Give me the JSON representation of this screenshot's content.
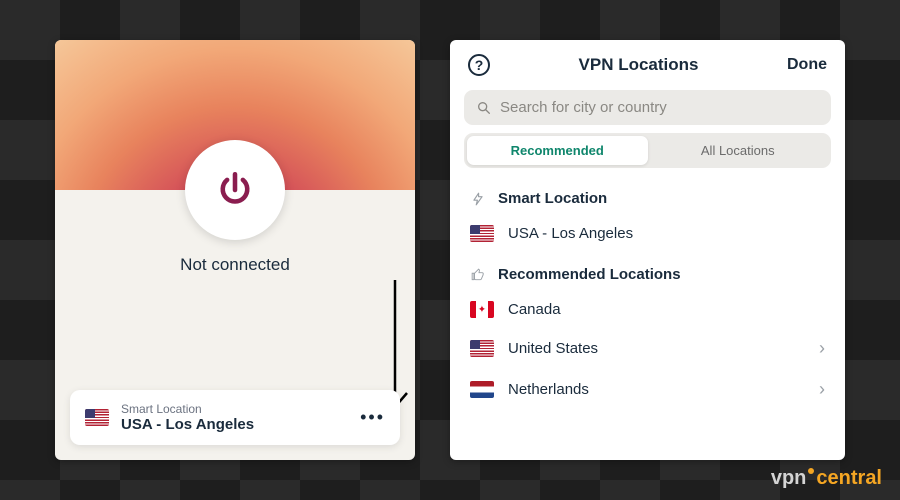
{
  "left": {
    "status": "Not connected",
    "location_label": "Smart Location",
    "location_value": "USA - Los Angeles"
  },
  "right": {
    "title": "VPN Locations",
    "done": "Done",
    "search_placeholder": "Search for city or country",
    "tabs": {
      "recommended": "Recommended",
      "all": "All Locations"
    },
    "smart_header": "Smart Location",
    "smart_location": "USA - Los Angeles",
    "rec_header": "Recommended Locations",
    "recommended": {
      "canada": "Canada",
      "us": "United States",
      "nl": "Netherlands"
    }
  },
  "watermark": {
    "a": "vpn",
    "b": "central"
  }
}
